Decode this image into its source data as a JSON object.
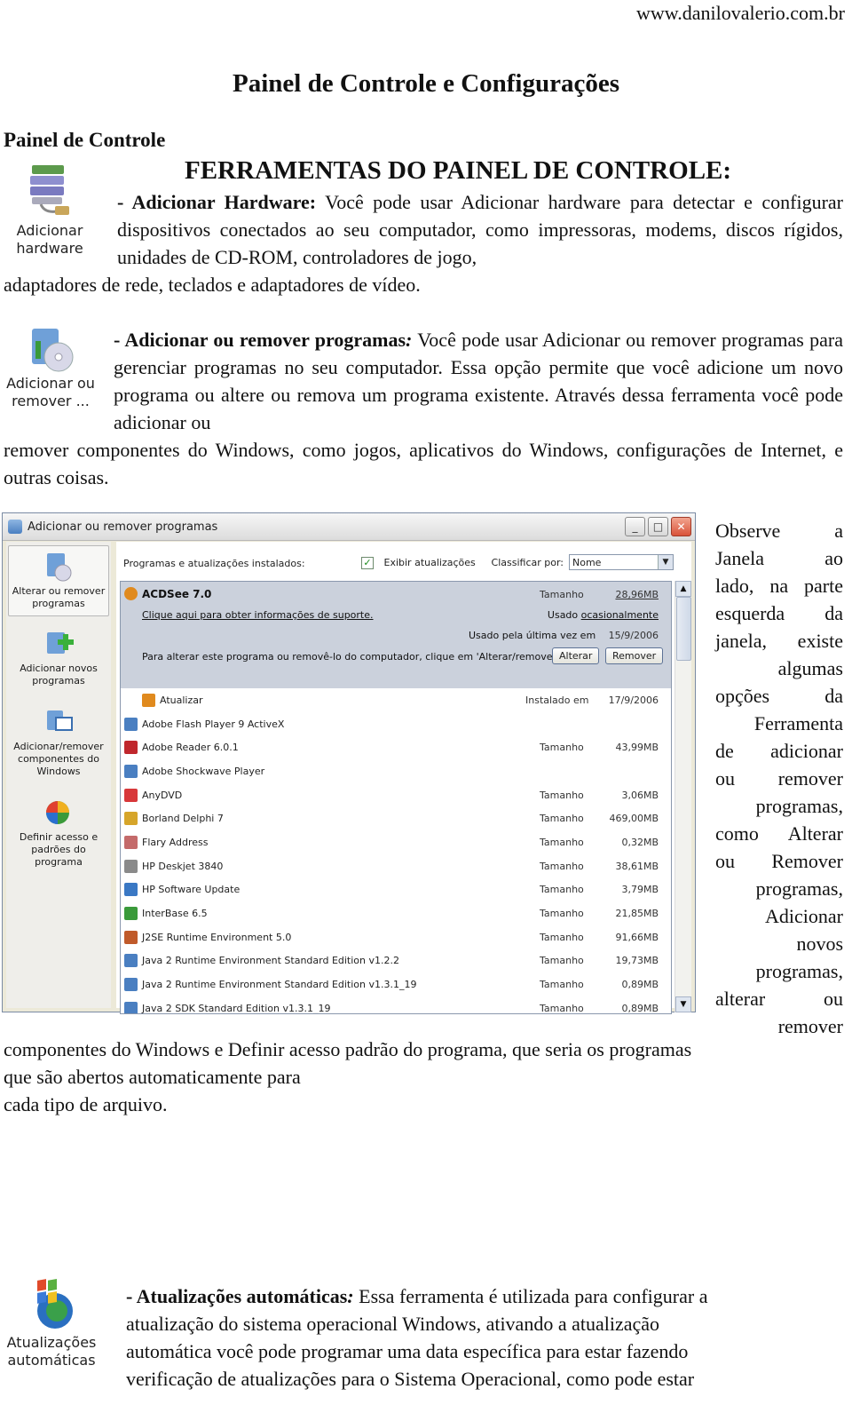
{
  "header": {
    "site": "www.danilovalerio.com.br",
    "title": "Painel de Controle e Configurações"
  },
  "section_title": "Painel de Controle",
  "tools_heading": "FERRAMENTAS DO PAINEL DE CONTROLE:",
  "items": [
    {
      "icon_name": "add-hardware-icon",
      "icon_label_1": "Adicionar",
      "icon_label_2": "hardware",
      "heading": "- Adicionar Hardware:",
      "text": " Você pode usar Adicionar hardware para detectar e configurar dispositivos conectados ao seu computador, como impressoras, modems, discos rígidos, unidades de CD-ROM, controladores de jogo,",
      "text_cont": "adaptadores de rede, teclados e adaptadores de vídeo."
    },
    {
      "icon_name": "add-remove-programs-icon",
      "icon_label_1": "Adicionar ou",
      "icon_label_2": "remover ...",
      "heading": "- Adicionar ou remover programas",
      "heading_colon": ":",
      "text": " Você pode usar Adicionar ou remover programas para gerenciar programas no seu computador. Essa opção permite que você adicione um novo programa ou altere ou remova um programa existente. Através dessa ferramenta você pode adicionar ou",
      "text_cont": "remover componentes do Windows, como jogos, aplicativos do Windows, configurações de Internet, e outras coisas."
    }
  ],
  "window": {
    "title": "Adicionar ou remover programas",
    "controls": {
      "minimize": "_",
      "maximize": "□",
      "close": "✕"
    },
    "sidebar": [
      {
        "label": "Alterar ou remover programas",
        "selected": true
      },
      {
        "label": "Adicionar novos programas",
        "selected": false
      },
      {
        "label": "Adicionar/remover componentes do Windows",
        "selected": false
      },
      {
        "label": "Definir acesso e padrões do programa",
        "selected": false
      }
    ],
    "installed_label": "Programas e atualizações instalados:",
    "show_updates_label": "Exibir atualizações",
    "show_updates_checked": true,
    "sort_label": "Classificar por:",
    "sort_value": "Nome",
    "selected_program": {
      "name": "ACDSee 7.0",
      "size_label": "Tamanho",
      "size": "28,96MB",
      "support_link": "Clique aqui para obter informações de suporte.",
      "used_label": "Usado",
      "used_value": "ocasionalmente",
      "last_used_label": "Usado pela última vez em",
      "last_used": "15/9/2006",
      "instruction": "Para alterar este programa ou removê-lo do computador, clique em 'Alterar/remover'.",
      "change_button": "Alterar",
      "remove_button": "Remover"
    },
    "programs": [
      {
        "name": "Atualizar",
        "key": "Instalado em",
        "value": "17/9/2006",
        "color": "#e08a1e"
      },
      {
        "name": "Adobe Flash Player 9 ActiveX",
        "key": "",
        "value": "",
        "color": "#4a7fc1"
      },
      {
        "name": "Adobe Reader 6.0.1",
        "key": "Tamanho",
        "value": "43,99MB",
        "color": "#c0272d"
      },
      {
        "name": "Adobe Shockwave Player",
        "key": "",
        "value": "",
        "color": "#4a7fc1"
      },
      {
        "name": "AnyDVD",
        "key": "Tamanho",
        "value": "3,06MB",
        "color": "#d8383a"
      },
      {
        "name": "Borland Delphi 7",
        "key": "Tamanho",
        "value": "469,00MB",
        "color": "#d6a52a"
      },
      {
        "name": "Flary Address",
        "key": "Tamanho",
        "value": "0,32MB",
        "color": "#c46a6a"
      },
      {
        "name": "HP Deskjet 3840",
        "key": "Tamanho",
        "value": "38,61MB",
        "color": "#8a8a8a"
      },
      {
        "name": "HP Software Update",
        "key": "Tamanho",
        "value": "3,79MB",
        "color": "#3a78c4"
      },
      {
        "name": "InterBase 6.5",
        "key": "Tamanho",
        "value": "21,85MB",
        "color": "#3a9a3a"
      },
      {
        "name": "J2SE Runtime Environment 5.0",
        "key": "Tamanho",
        "value": "91,66MB",
        "color": "#c05a2a"
      },
      {
        "name": "Java 2 Runtime Environment Standard Edition v1.2.2",
        "key": "Tamanho",
        "value": "19,73MB",
        "color": "#4a7fc1"
      },
      {
        "name": "Java 2 Runtime Environment Standard Edition v1.3.1_19",
        "key": "Tamanho",
        "value": "0,89MB",
        "color": "#4a7fc1"
      },
      {
        "name": "Java 2 SDK Standard Edition v1.3.1_19",
        "key": "Tamanho",
        "value": "0,89MB",
        "color": "#4a7fc1"
      }
    ]
  },
  "side_text": [
    "Observe a",
    "Janela ao",
    "lado, na parte",
    "esquerda da",
    "janela, existe",
    "algumas",
    "opções da",
    "Ferramenta",
    "de adicionar",
    "ou remover",
    "programas,",
    "como Alterar",
    "ou Remover",
    "programas,",
    "Adicionar",
    "novos",
    "programas,",
    "alterar ou",
    "remover"
  ],
  "continuation": [
    "componentes do Windows e Definir acesso padrão do programa, que seria os programas",
    "que são abertos automaticamente para",
    "cada tipo de arquivo."
  ],
  "updates": {
    "icon_label_1": "Atualizações",
    "icon_label_2": "automáticas",
    "heading": "- Atualizações automáticas",
    "heading_colon": ":",
    "lines": [
      " Essa ferramenta é utilizada para configurar a",
      "atualização do sistema operacional Windows, ativando a atualização",
      "automática você pode programar uma data específica para estar fazendo",
      "verificação de atualizações para o Sistema Operacional, como pode estar"
    ]
  }
}
